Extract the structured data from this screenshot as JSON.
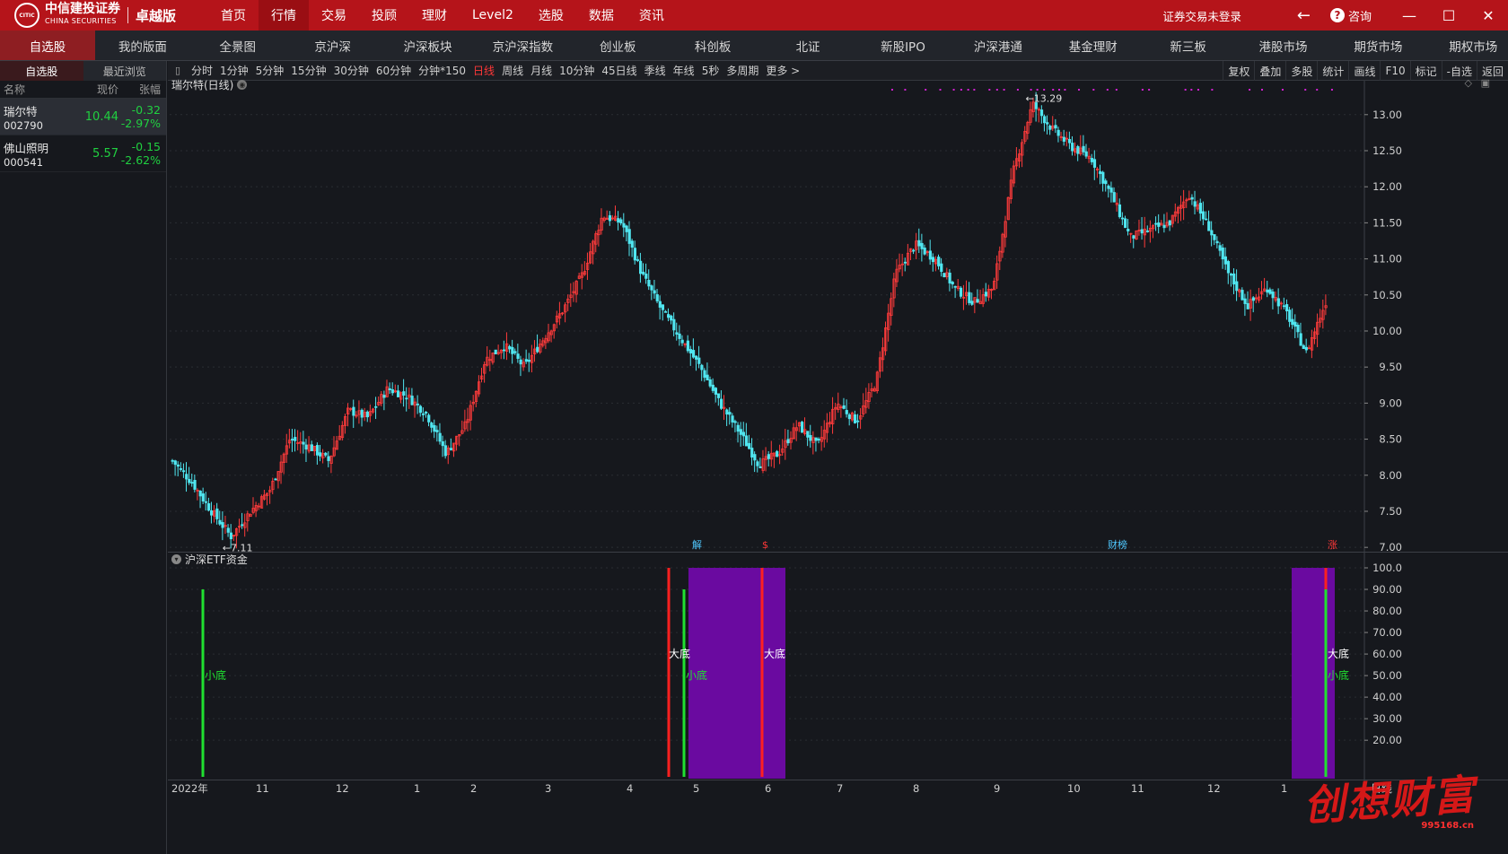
{
  "logo": {
    "mark": "CITIC",
    "name_cn": "中信建投证券",
    "name_en": "CHINA SECURITIES",
    "edition": "卓越版"
  },
  "topnav": [
    {
      "label": "首页",
      "active": false
    },
    {
      "label": "行情",
      "active": true
    },
    {
      "label": "交易",
      "active": false
    },
    {
      "label": "投顾",
      "active": false
    },
    {
      "label": "理财",
      "active": false
    },
    {
      "label": "Level2",
      "active": false
    },
    {
      "label": "选股",
      "active": false
    },
    {
      "label": "数据",
      "active": false
    },
    {
      "label": "资讯",
      "active": false
    }
  ],
  "topright": {
    "login_status": "证券交易未登录",
    "consult": "咨询"
  },
  "markets": [
    "自选股",
    "我的版面",
    "全景图",
    "京沪深",
    "沪深板块",
    "京沪深指数",
    "创业板",
    "科创板",
    "北证",
    "新股IPO",
    "沪深港通",
    "基金理财",
    "新三板",
    "港股市场",
    "期货市场",
    "期权市场"
  ],
  "left": {
    "tabs": [
      "自选股",
      "最近浏览"
    ],
    "headers": {
      "name": "名称",
      "price": "现价",
      "change": "张幅"
    },
    "stocks": [
      {
        "name": "瑞尔特",
        "code": "002790",
        "price": "10.44",
        "change": "-0.32",
        "pct": "-2.97%"
      },
      {
        "name": "佛山照明",
        "code": "000541",
        "price": "5.57",
        "change": "-0.15",
        "pct": "-2.62%"
      }
    ]
  },
  "periods": [
    "分时",
    "1分钟",
    "5分钟",
    "15分钟",
    "30分钟",
    "60分钟",
    "分钟*150",
    "日线",
    "周线",
    "月线",
    "10分钟",
    "45日线",
    "季线",
    "年线",
    "5秒",
    "多周期",
    "更多 >"
  ],
  "active_period": "日线",
  "tools": [
    "复权",
    "叠加",
    "多股",
    "统计",
    "画线",
    "F10",
    "标记",
    "-自选",
    "返回"
  ],
  "main_title": "瑞尔特(日线)",
  "indicator_title": "沪深ETF资金",
  "colors": {
    "up": "#ff3b3b",
    "down": "#50e6f0",
    "green_line": "#20e030",
    "red_line": "#ff2020",
    "purple": "#6a0aa0",
    "magenta": "#d020d0"
  },
  "chart_data": [
    {
      "type": "candlestick",
      "title": "瑞尔特(日线)",
      "y_ticks": [
        "13.00",
        "12.50",
        "12.00",
        "11.50",
        "11.00",
        "10.50",
        "10.00",
        "9.50",
        "9.00",
        "8.50",
        "8.00",
        "7.50",
        "7.00"
      ],
      "ylim": [
        6.94,
        13.47
      ],
      "x_labels": [
        "2022年",
        "11",
        "12",
        "1",
        "2",
        "3",
        "4",
        "5",
        "6",
        "7",
        "8",
        "9",
        "10",
        "11",
        "12",
        "1"
      ],
      "high_annotation": "13.29",
      "low_annotation": "7.11",
      "events": [
        "解",
        "$",
        "财榜",
        "涨"
      ],
      "close_path": [
        8.2,
        7.9,
        7.5,
        7.15,
        7.5,
        7.8,
        8.5,
        8.4,
        8.2,
        8.9,
        8.8,
        9.2,
        9.1,
        8.85,
        8.3,
        8.7,
        9.6,
        9.8,
        9.5,
        9.9,
        10.3,
        10.8,
        11.6,
        11.5,
        10.8,
        10.3,
        9.9,
        9.5,
        9.0,
        8.6,
        8.15,
        8.3,
        8.7,
        8.4,
        9.0,
        8.75,
        9.3,
        10.8,
        11.2,
        11.0,
        10.6,
        10.4,
        10.6,
        12.2,
        13.15,
        12.8,
        12.55,
        12.4,
        11.9,
        11.3,
        11.4,
        11.5,
        11.9,
        11.45,
        10.8,
        10.35,
        10.6,
        10.25,
        9.7,
        10.4
      ],
      "markers_x_labels": ""
    },
    {
      "type": "indicator",
      "title": "沪深ETF资金",
      "y_ticks": [
        "100.0",
        "90.00",
        "80.00",
        "70.00",
        "60.00",
        "50.00",
        "40.00",
        "30.00",
        "20.00"
      ],
      "ylim": [
        10,
        100
      ],
      "labels": [
        "小底",
        "大底",
        "小底",
        "大底",
        "大底",
        "小底"
      ],
      "bottom_label": "日线"
    }
  ],
  "watermark": {
    "text": "创想财富",
    "url": "995168.cn"
  }
}
